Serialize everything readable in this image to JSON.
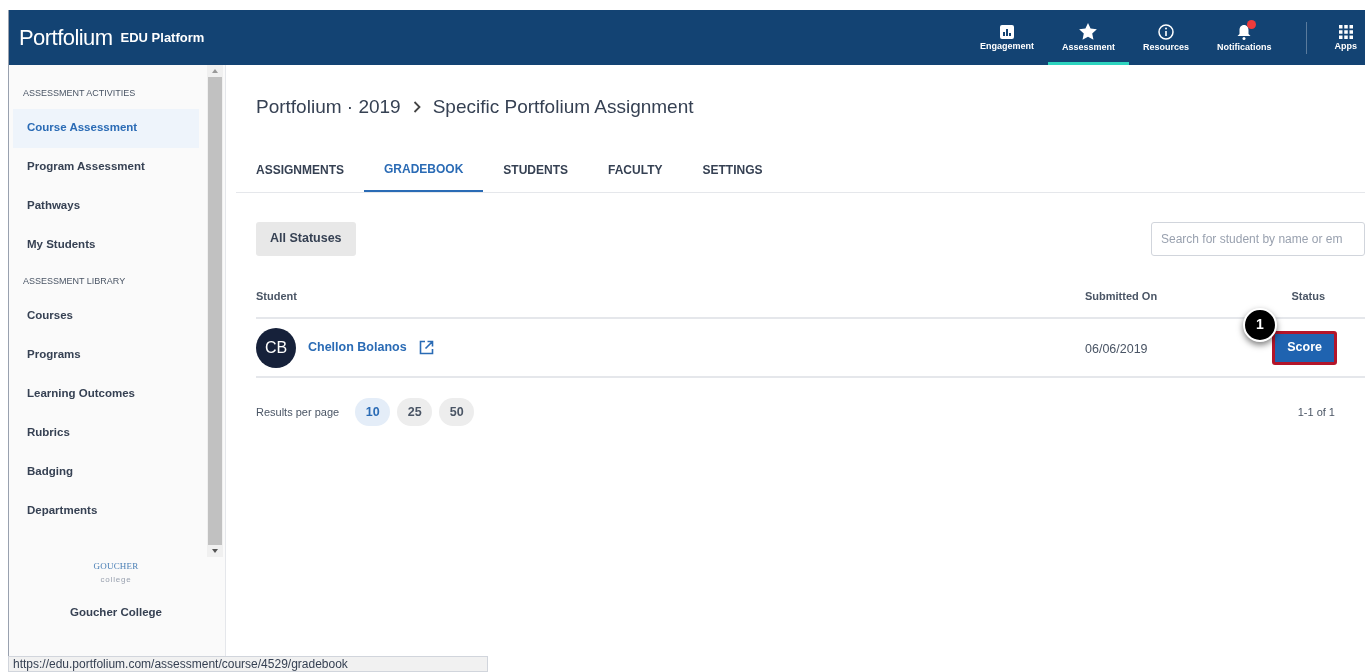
{
  "header": {
    "logo": "Portfolium",
    "subtitle": "EDU Platform",
    "nav": [
      {
        "kind": "chart",
        "label": "Engagement",
        "selected": false,
        "badge": false
      },
      {
        "kind": "star",
        "label": "Assessment",
        "selected": true,
        "badge": false
      },
      {
        "kind": "info",
        "label": "Resources",
        "selected": false,
        "badge": false
      },
      {
        "kind": "bell",
        "label": "Notifications",
        "selected": false,
        "badge": true
      },
      {
        "kind": "grid",
        "label": "Apps",
        "selected": false,
        "badge": false
      }
    ]
  },
  "sidebar": {
    "sections": [
      {
        "title": "ASSESSMENT ACTIVITIES",
        "items": [
          {
            "label": "Course Assessment",
            "selected": true
          },
          {
            "label": "Program Assessment",
            "selected": false
          },
          {
            "label": "Pathways",
            "selected": false
          },
          {
            "label": "My Students",
            "selected": false
          }
        ]
      },
      {
        "title": "ASSESSMENT LIBRARY",
        "items": [
          {
            "label": "Courses",
            "selected": false
          },
          {
            "label": "Programs",
            "selected": false
          },
          {
            "label": "Learning Outcomes",
            "selected": false
          },
          {
            "label": "Rubrics",
            "selected": false
          },
          {
            "label": "Badging",
            "selected": false
          },
          {
            "label": "Departments",
            "selected": false
          }
        ]
      }
    ],
    "school_logo": "GOUCHER",
    "school_logo_sub": "college",
    "school_name": "Goucher College"
  },
  "breadcrumb": [
    "Portfolium · 2019",
    "Specific Portfolium Assignment"
  ],
  "tabs": [
    {
      "label": "ASSIGNMENTS",
      "selected": false
    },
    {
      "label": "GRADEBOOK",
      "selected": true
    },
    {
      "label": "STUDENTS",
      "selected": false
    },
    {
      "label": "FACULTY",
      "selected": false
    },
    {
      "label": "SETTINGS",
      "selected": false
    }
  ],
  "filter_button": "All Statuses",
  "search": {
    "placeholder": "Search for student by name or em"
  },
  "table": {
    "columns": [
      "Student",
      "Submitted On",
      "Status"
    ],
    "rows": [
      {
        "initials": "CB",
        "name": "Chellon Bolanos",
        "submitted": "06/06/2019",
        "action": "Score",
        "callout": "1"
      }
    ]
  },
  "pagination": {
    "label": "Results per page",
    "sizes": [
      {
        "label": "10",
        "selected": true
      },
      {
        "label": "25",
        "selected": false
      },
      {
        "label": "50",
        "selected": false
      }
    ],
    "range": "1-1 of 1"
  },
  "status_bar": "https://edu.portfolium.com/assessment/course/4529/gradebook"
}
